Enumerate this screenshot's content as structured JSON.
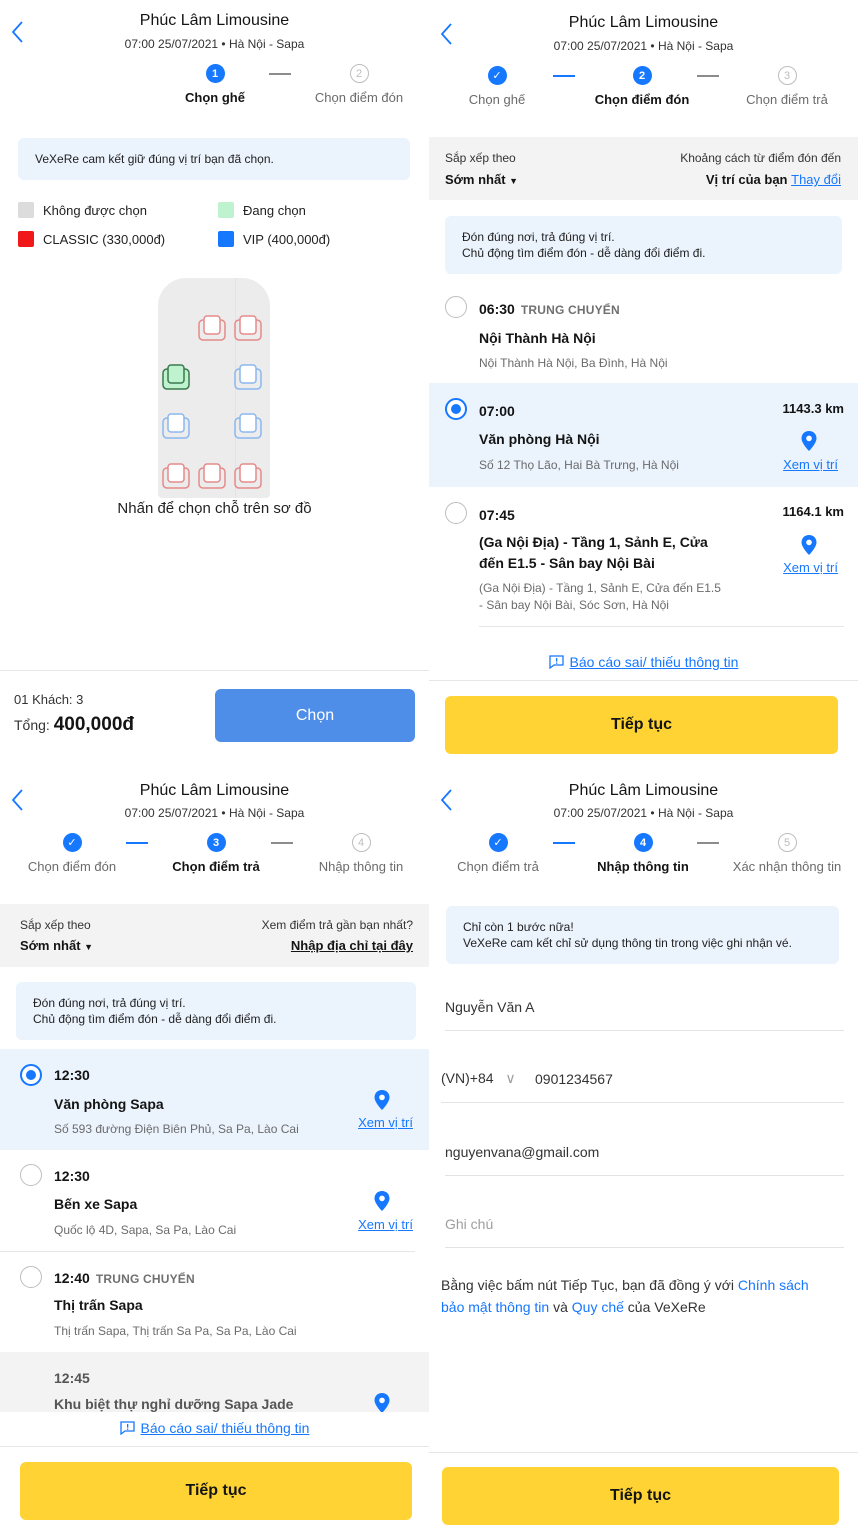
{
  "header": {
    "title": "Phúc Lâm Limousine",
    "subtitle": "07:00 25/07/2021 • Hà Nội - Sapa"
  },
  "colors": {
    "accent_blue": "#1677ff",
    "cta_yellow": "#ffd333",
    "selected_bg": "#ebf3fd"
  },
  "screen1": {
    "steps": [
      {
        "num": "1",
        "label": "Chọn ghế",
        "state": "active"
      },
      {
        "num": "2",
        "label": "Chọn điểm đón",
        "state": "pending"
      }
    ],
    "notice": "VeXeRe cam kết giữ đúng vị trí bạn đã chọn.",
    "legend": {
      "unavailable": "Không được chọn",
      "selecting": "Đang chọn",
      "classic": "CLASSIC (330,000đ)",
      "vip": "VIP (400,000đ)"
    },
    "hint": "Nhấn để chọn chỗ trên sơ đồ",
    "footer": {
      "guests": "01 Khách: 3",
      "total_label": "Tổng:",
      "total_value": "400,000đ",
      "button": "Chọn"
    }
  },
  "screen2": {
    "steps": [
      {
        "num": "✓",
        "label": "Chọn ghế",
        "state": "done"
      },
      {
        "num": "2",
        "label": "Chọn điểm đón",
        "state": "active"
      },
      {
        "num": "3",
        "label": "Chọn điểm trả",
        "state": "pending"
      }
    ],
    "sort": {
      "label": "Sắp xếp theo",
      "value": "Sớm nhất",
      "right_label": "Khoảng cách từ điểm đón đến",
      "right_value": "Vị trí của bạn",
      "right_link": "Thay đổi"
    },
    "notice_line1": "Đón đúng nơi, trả đúng vị trí.",
    "notice_line2": "Chủ động tìm điểm đón - dễ dàng đổi điểm đi.",
    "points": [
      {
        "time": "06:30",
        "tag": "TRUNG CHUYỂN",
        "name": "Nội Thành Hà Nội",
        "address": "Nội Thành Hà Nội, Ba Đình, Hà Nội"
      },
      {
        "time": "07:00",
        "distance": "1143.3 km",
        "name": "Văn phòng Hà Nội",
        "address": "Số 12 Thọ Lão, Hai Bà Trưng, Hà Nội",
        "map": "Xem vị trí"
      },
      {
        "time": "07:45",
        "distance": "1164.1 km",
        "name_line1": "(Ga Nội Địa) - Tầng 1, Sảnh E, Cửa",
        "name_line2": "đến E1.5 - Sân bay Nội Bài",
        "address_line1": "(Ga Nội Địa) - Tầng 1, Sảnh E, Cửa đến E1.5",
        "address_line2": "- Sân bay Nội Bài, Sóc Sơn, Hà Nội",
        "map": "Xem vị trí"
      }
    ],
    "report": "Báo cáo sai/ thiếu thông tin",
    "button": "Tiếp tục"
  },
  "screen3": {
    "steps": [
      {
        "num": "✓",
        "label": "Chọn điểm đón",
        "state": "done"
      },
      {
        "num": "3",
        "label": "Chọn điểm trả",
        "state": "active"
      },
      {
        "num": "4",
        "label": "Nhập thông tin",
        "state": "pending"
      }
    ],
    "sort": {
      "label": "Sắp xếp theo",
      "value": "Sớm nhất",
      "right_label": "Xem điểm trả gần bạn nhất?",
      "right_link": "Nhập địa chỉ tại đây"
    },
    "notice_line1": "Đón đúng nơi, trả đúng vị trí.",
    "notice_line2": "Chủ động tìm điểm đón - dễ dàng đổi điểm đi.",
    "points": [
      {
        "time": "12:30",
        "name": "Văn phòng Sapa",
        "address": "Số 593 đường Điện Biên Phủ, Sa Pa, Lào Cai",
        "map": "Xem vị trí"
      },
      {
        "time": "12:30",
        "name": "Bến xe Sapa",
        "address": "Quốc lộ 4D, Sapa, Sa Pa, Lào Cai",
        "map": "Xem vị trí"
      },
      {
        "time": "12:40",
        "tag": "TRUNG CHUYỂN",
        "name": "Thị trấn Sapa",
        "address": "Thị trấn Sapa, Thị trấn Sa Pa, Sa Pa, Lào Cai"
      },
      {
        "time": "12:45",
        "name": "Khu biệt thự nghỉ dưỡng Sapa Jade"
      }
    ],
    "report": "Báo cáo sai/ thiếu thông tin",
    "button": "Tiếp tục"
  },
  "screen4": {
    "steps": [
      {
        "num": "✓",
        "label": "Chọn điểm trả",
        "state": "done"
      },
      {
        "num": "4",
        "label": "Nhập thông tin",
        "state": "active"
      },
      {
        "num": "5",
        "label": "Xác nhận thông tin",
        "state": "pending"
      }
    ],
    "notice_line1": "Chỉ còn 1 bước nữa!",
    "notice_line2": "VeXeRe cam kết chỉ sử dụng thông tin trong việc ghi nhận vé.",
    "form": {
      "name": "Nguyễn Văn A",
      "country_code": "(VN)+84",
      "phone": "0901234567",
      "email": "nguyenvana@gmail.com",
      "note_placeholder": "Ghi chú"
    },
    "terms": {
      "prefix": "Bằng việc bấm nút Tiếp Tục, bạn đã đồng ý với ",
      "link1_a": "Chính sách",
      "link1_b": "bảo mật thông tin",
      "mid": " và ",
      "link2": "Quy chế",
      "suffix": " của VeXeRe"
    },
    "button": "Tiếp tục"
  }
}
